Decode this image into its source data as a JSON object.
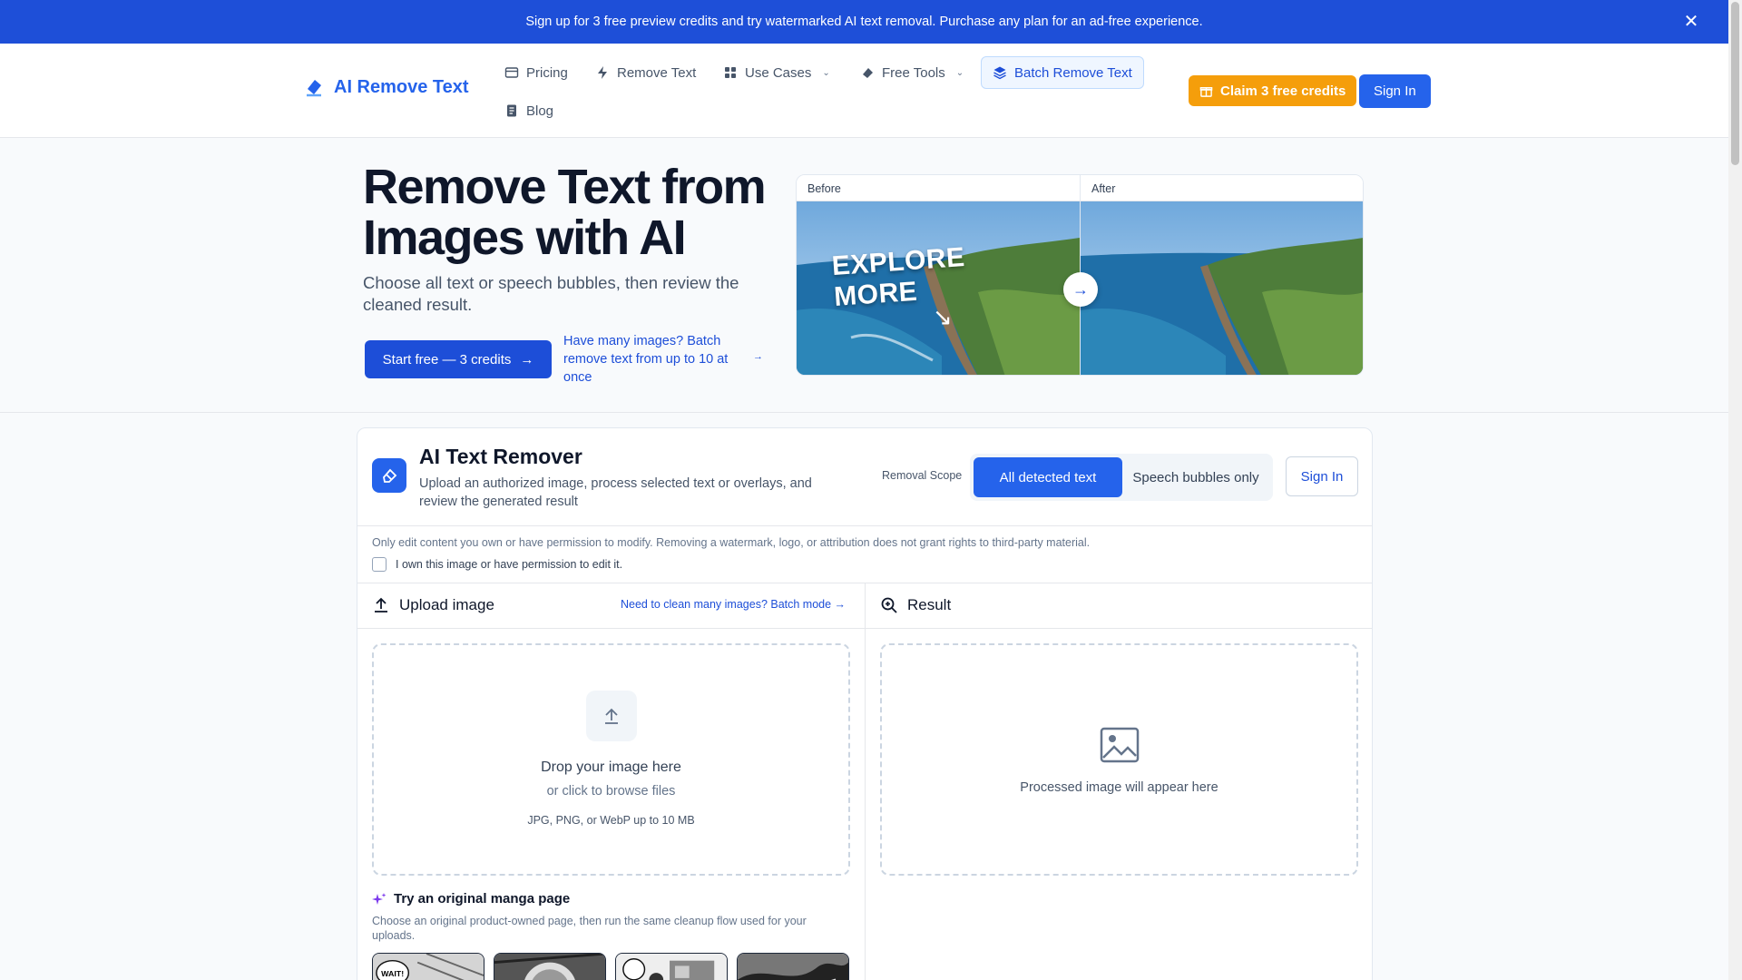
{
  "banner": {
    "text": "Sign up for 3 free preview credits and try watermarked AI text removal. Purchase any plan for an ad-free experience.",
    "close_icon": "close-icon"
  },
  "header": {
    "logo_text": "AI Remove Text",
    "nav": {
      "pricing": "Pricing",
      "remove_text": "Remove Text",
      "use_cases": "Use Cases",
      "free_tools": "Free Tools",
      "batch": "Batch Remove Text",
      "blog": "Blog"
    },
    "claim_label": "Claim 3 free credits",
    "signin_label": "Sign In"
  },
  "hero": {
    "title": "Remove Text from Images with AI",
    "subtitle": "Choose all text or speech bubbles, then review the cleaned result.",
    "start_label": "Start free — 3 credits",
    "batch_link": "Have many images? Batch remove text from up to 10 at once",
    "compare": {
      "before_label": "Before",
      "after_label": "After",
      "overlay_line1": "EXPLORE",
      "overlay_line2": "MORE"
    }
  },
  "tool": {
    "title": "AI Text Remover",
    "description": "Upload an authorized image, process selected text or overlays, and review the generated result",
    "scope_label": "Removal Scope",
    "scope_options": [
      "All detected text",
      "Speech bubbles only"
    ],
    "scope_selected": "All detected text",
    "signin_label": "Sign In",
    "notice": "Only edit content you own or have permission to modify. Removing a watermark, logo, or attribution does not grant rights to third-party material.",
    "consent_label": "I own this image or have permission to edit it.",
    "consent_checked": false,
    "upload": {
      "heading": "Upload image",
      "batch_link": "Need to clean many images? Batch mode →",
      "drop_title": "Drop your image here",
      "drop_sub": "or click to browse files",
      "formats": "JPG, PNG, or WebP up to 10 MB"
    },
    "result": {
      "heading": "Result",
      "placeholder": "Processed image will appear here"
    },
    "samples": {
      "heading": "Try an original manga page",
      "description": "Choose an original product-owned page, then run the same cleanup flow used for your uploads.",
      "thumb_labels": [
        "WAIT!",
        "",
        "",
        ""
      ]
    }
  },
  "colors": {
    "brand_blue": "#2563eb",
    "banner_blue": "#1e4fd8",
    "claim_amber": "#f59e0b"
  }
}
